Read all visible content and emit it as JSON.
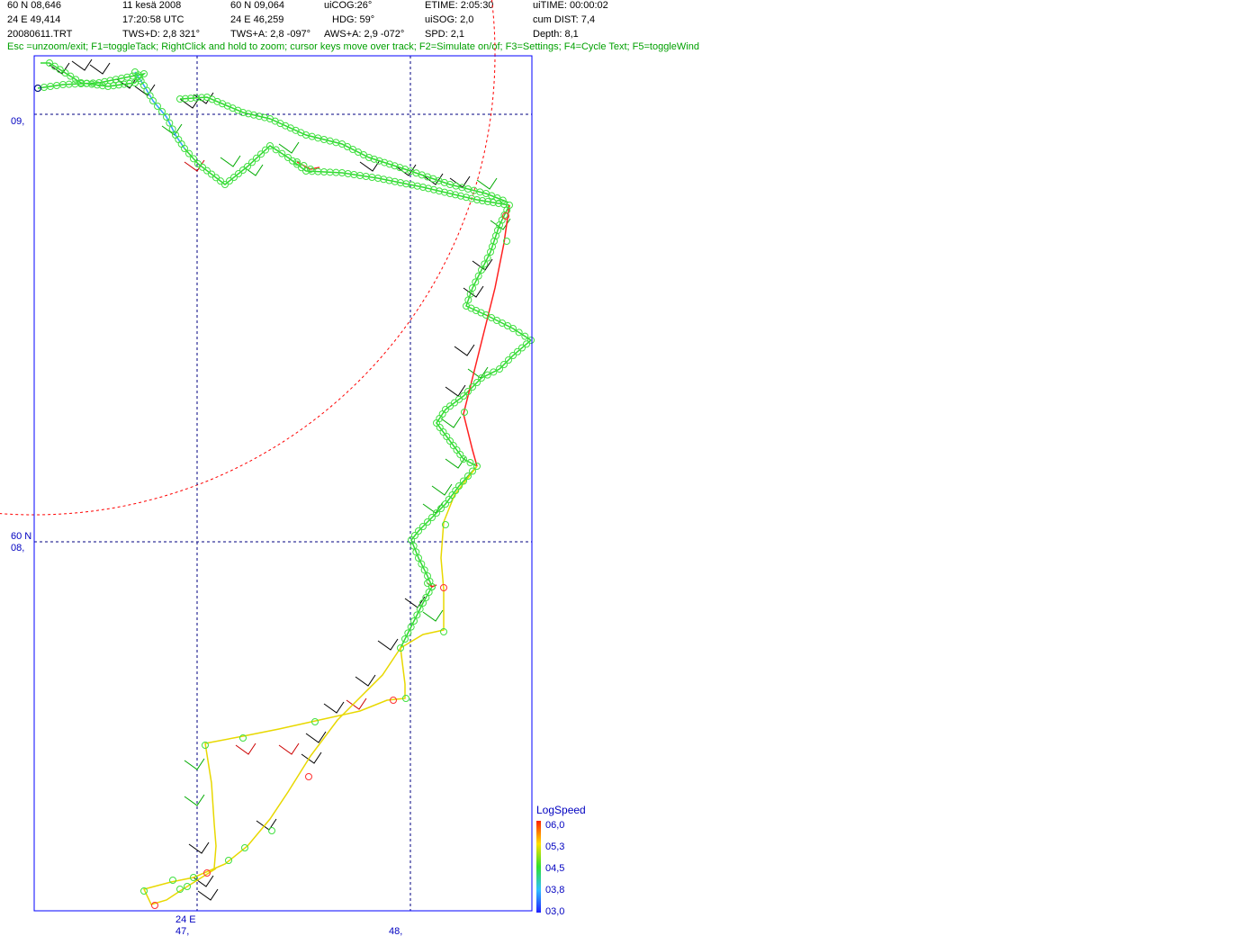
{
  "status": {
    "lat": "60 N 08,646",
    "lon": "24 E 49,414",
    "file": "20080611.TRT",
    "date": "11 kesä 2008",
    "time": "17:20:58  UTC",
    "tws_d": "TWS+D: 2,8 321°",
    "cursor_lat": "60 N 09,064",
    "cursor_lon": "24 E 46,259",
    "tws_a": "TWS+A: 2,8 -097°",
    "cog": "uiCOG:26°",
    "hdg": "HDG: 59°",
    "aws_a": "AWS+A: 2,9 -072°",
    "etime": "ETIME: 2:05:30",
    "sog": "uiSOG: 2,0",
    "spd": "SPD: 2,1",
    "uitime": "uiTIME: 00:00:02",
    "cum_dist": "cum DIST: 7,4",
    "depth": "Depth: 8,1"
  },
  "help_text": "Esc =unzoom/exit; F1=toggleTack; RightClick and hold to zoom; cursor keys move over track; F2=Simulate on/of; F3=Settings; F4=Cycle Text; F5=toggleWind",
  "axis": {
    "lat_top": "09,",
    "lat_mid_a": "60 N",
    "lat_mid_b": "08,",
    "lon_left_a": "24 E",
    "lon_left_b": "47,",
    "lon_right": "48,"
  },
  "legend": {
    "title": "LogSpeed",
    "levels": [
      "06,0",
      "05,3",
      "04,5",
      "03,8",
      "03,0"
    ]
  },
  "colors": {
    "frame": "#0000ff",
    "grid": "#000080",
    "circle": "#ff0000",
    "help": "#00a000",
    "label": "#0000c0"
  }
}
